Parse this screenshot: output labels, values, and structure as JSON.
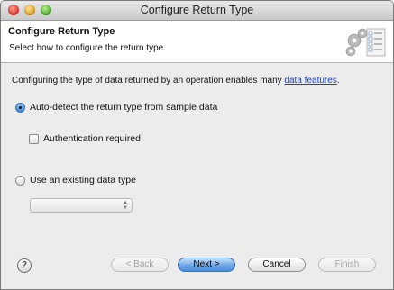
{
  "window": {
    "title": "Configure Return Type"
  },
  "banner": {
    "title": "Configure Return Type",
    "description": "Select how to configure the return type."
  },
  "content": {
    "intro_text": "Configuring the type of data returned by an operation enables many ",
    "intro_link": "data features",
    "intro_end": ".",
    "option_autodetect": "Auto-detect the return type from sample data",
    "auth_required": "Authentication required",
    "option_existing": "Use an existing data type",
    "existing_type_value": ""
  },
  "footer": {
    "help_glyph": "?",
    "back_label": "< Back",
    "next_label": "Next >",
    "cancel_label": "Cancel",
    "finish_label": "Finish"
  },
  "state": {
    "selected_option": "auto-detect",
    "auth_required_checked": false
  }
}
